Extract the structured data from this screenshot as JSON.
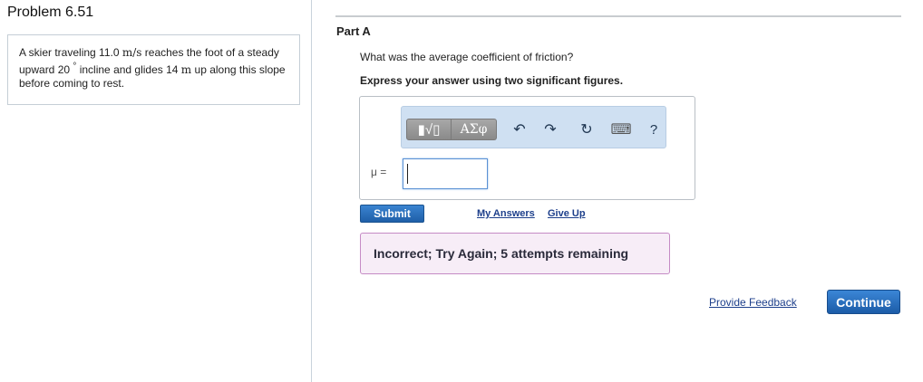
{
  "problem": {
    "title": "Problem 6.51",
    "text_1": "A skier traveling 11.0 ",
    "unit_speed": "m/s",
    "text_2": " reaches the foot of a steady upward 20 ",
    "degree": "°",
    "text_3": " incline and glides 14 ",
    "unit_m": "m",
    "text_4": " up along this slope before coming to rest."
  },
  "part": {
    "title": "Part A",
    "question": "What was the average coefficient of friction?",
    "instruction": "Express your answer using two significant figures."
  },
  "toolbar": {
    "templates_label": "▮√▯",
    "symbols_label": "ΑΣφ",
    "undo_glyph": "↶",
    "redo_glyph": "↷",
    "reset_glyph": "↻",
    "keyboard_glyph": "⌨",
    "help_label": "?"
  },
  "answer": {
    "variable_label": "μ =",
    "value": ""
  },
  "actions": {
    "submit_label": "Submit",
    "my_answers_label": "My Answers",
    "give_up_label": "Give Up"
  },
  "feedback": {
    "message": "Incorrect; Try Again; 5 attempts remaining"
  },
  "footer": {
    "provide_feedback_label": "Provide Feedback",
    "continue_label": "Continue"
  },
  "colors": {
    "accent": "#1f5fa8",
    "toolbar_bg": "#cfe0f2",
    "feedback_bg": "#f7edf7",
    "feedback_border": "#c58bc5"
  }
}
